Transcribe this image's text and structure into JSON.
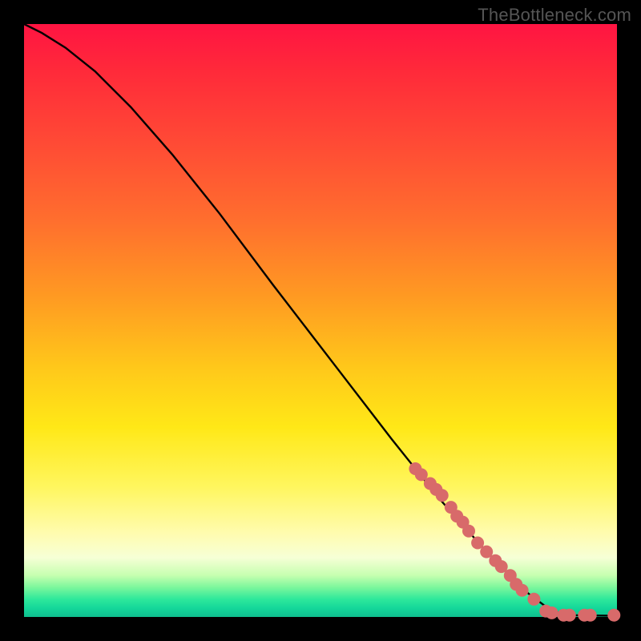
{
  "watermark": "TheBottleneck.com",
  "colors": {
    "background": "#000000",
    "curve": "#000000",
    "marker": "#d86a6a",
    "gradient_top": "#ff1442",
    "gradient_bottom": "#0fbf8e"
  },
  "chart_data": {
    "type": "line",
    "title": "",
    "xlabel": "",
    "ylabel": "",
    "xlim": [
      0,
      100
    ],
    "ylim": [
      0,
      100
    ],
    "grid": false,
    "legend": false,
    "curve_points": [
      {
        "x": 0,
        "y": 100
      },
      {
        "x": 3,
        "y": 98.5
      },
      {
        "x": 7,
        "y": 96
      },
      {
        "x": 12,
        "y": 92
      },
      {
        "x": 18,
        "y": 86
      },
      {
        "x": 25,
        "y": 78
      },
      {
        "x": 33,
        "y": 68
      },
      {
        "x": 42,
        "y": 56
      },
      {
        "x": 52,
        "y": 43
      },
      {
        "x": 62,
        "y": 30
      },
      {
        "x": 70,
        "y": 20
      },
      {
        "x": 78,
        "y": 11
      },
      {
        "x": 85,
        "y": 4
      },
      {
        "x": 89,
        "y": 1
      },
      {
        "x": 92,
        "y": 0.3
      },
      {
        "x": 100,
        "y": 0.2
      }
    ],
    "markers": [
      {
        "x": 66,
        "y": 25
      },
      {
        "x": 67,
        "y": 24
      },
      {
        "x": 68.5,
        "y": 22.5
      },
      {
        "x": 69.5,
        "y": 21.5
      },
      {
        "x": 70.5,
        "y": 20.5
      },
      {
        "x": 72,
        "y": 18.5
      },
      {
        "x": 73,
        "y": 17
      },
      {
        "x": 74,
        "y": 16
      },
      {
        "x": 75,
        "y": 14.5
      },
      {
        "x": 76.5,
        "y": 12.5
      },
      {
        "x": 78,
        "y": 11
      },
      {
        "x": 79.5,
        "y": 9.5
      },
      {
        "x": 80.5,
        "y": 8.5
      },
      {
        "x": 82,
        "y": 7
      },
      {
        "x": 83,
        "y": 5.5
      },
      {
        "x": 84,
        "y": 4.5
      },
      {
        "x": 86,
        "y": 3
      },
      {
        "x": 88,
        "y": 1
      },
      {
        "x": 89,
        "y": 0.7
      },
      {
        "x": 91,
        "y": 0.3
      },
      {
        "x": 92,
        "y": 0.3
      },
      {
        "x": 94.5,
        "y": 0.3
      },
      {
        "x": 95.5,
        "y": 0.3
      },
      {
        "x": 99.5,
        "y": 0.3
      }
    ],
    "marker_radius": 8
  }
}
